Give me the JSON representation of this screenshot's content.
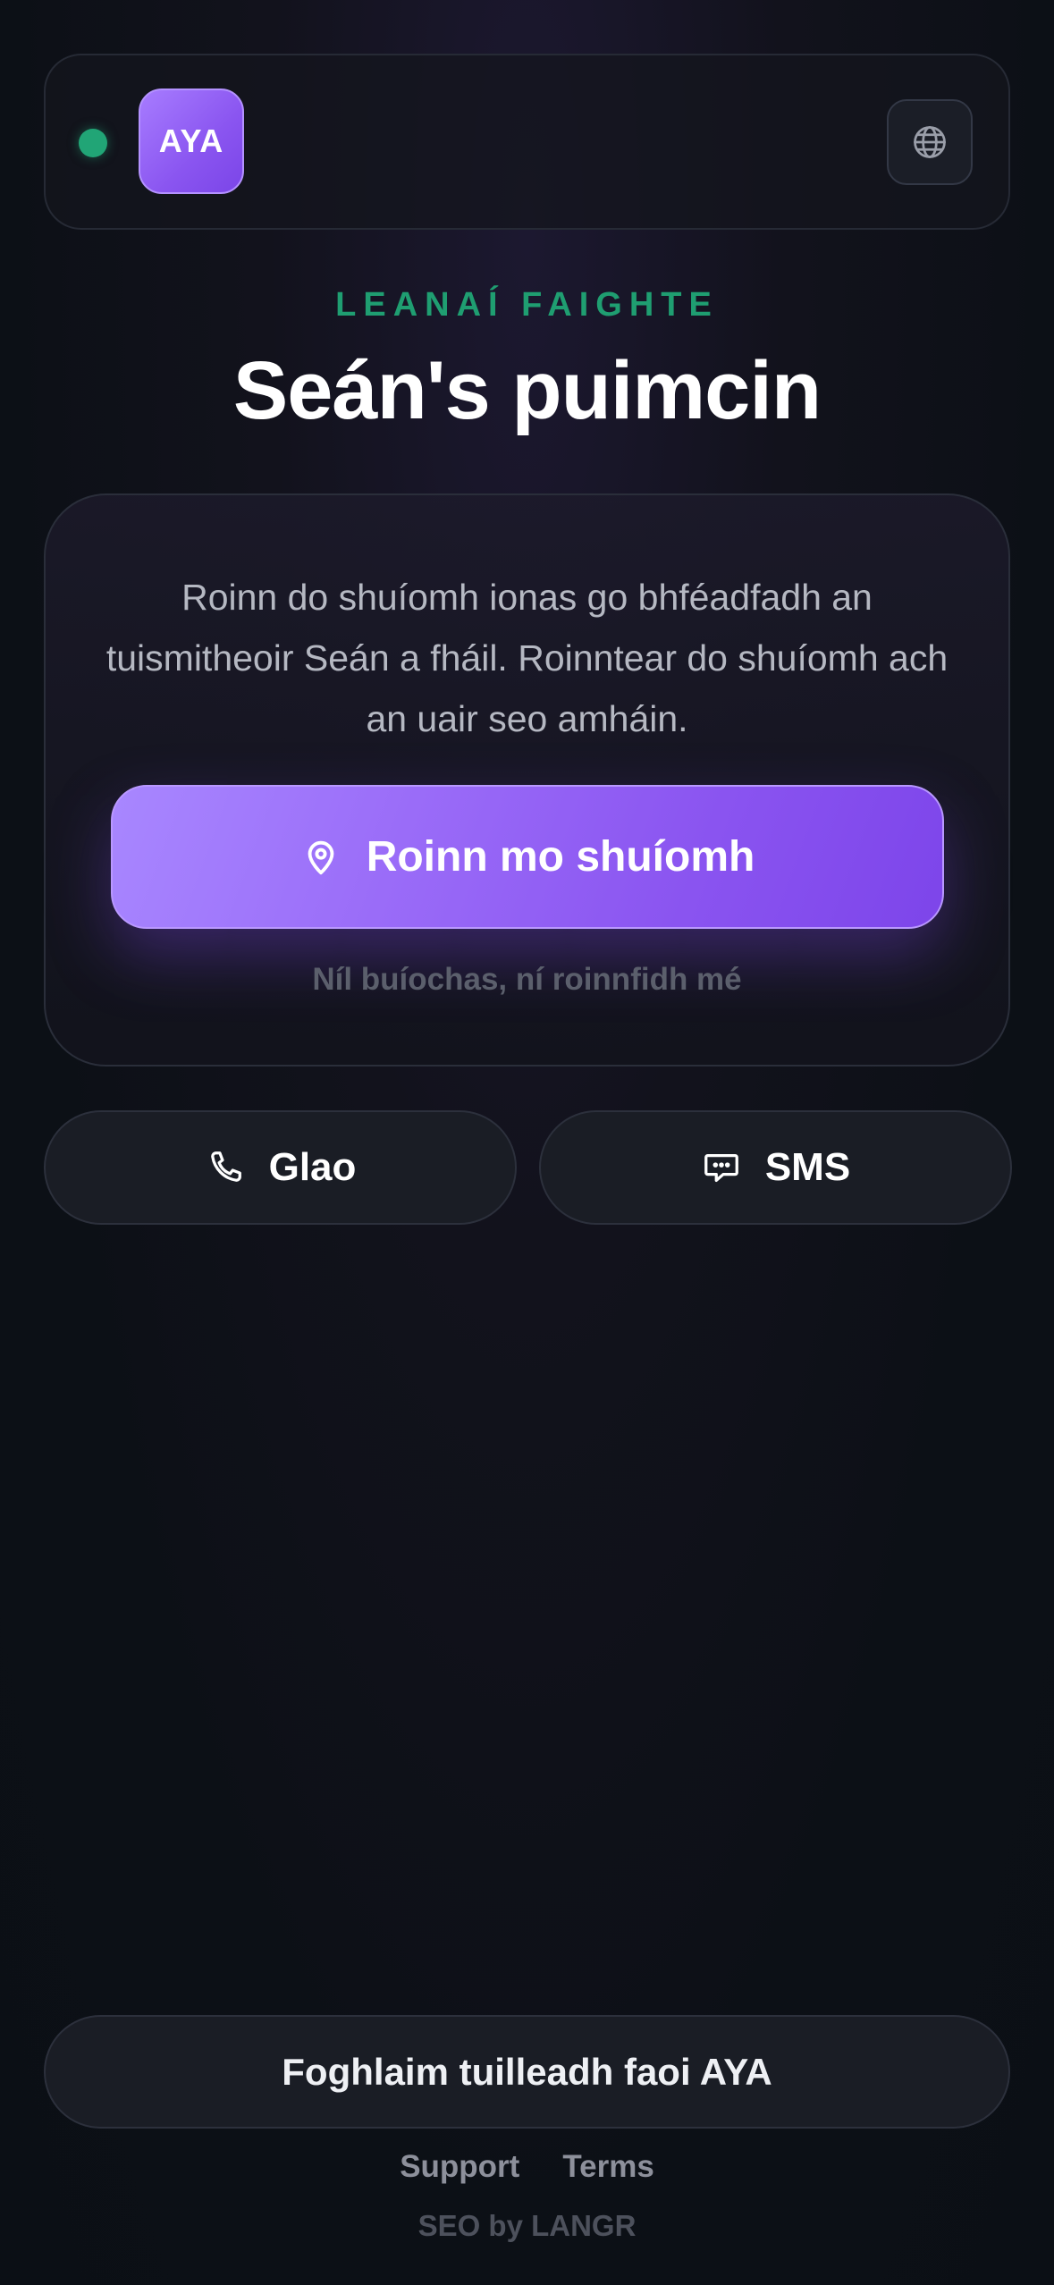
{
  "header": {
    "logo_text": "AYA",
    "status": "online",
    "status_color": "#21a576",
    "language_icon": "globe-icon"
  },
  "hero": {
    "eyebrow": "LEANAÍ FAIGHTE",
    "title": "Seán's puimcin"
  },
  "card": {
    "description": "Roinn do shuíomh ionas go bhféadfadh an tuismitheoir Seán a fháil. Roinntear do shuíomh ach an uair seo amháin.",
    "share_button_label": "Roinn mo shuíomh",
    "share_button_icon": "location-pin-icon",
    "decline_label": "Níl buíochas, ní roinnfidh mé"
  },
  "actions": {
    "call_label": "Glao",
    "call_icon": "phone-icon",
    "sms_label": "SMS",
    "sms_icon": "message-icon"
  },
  "footer": {
    "learn_more_label": "Foghlaim tuilleadh faoi AYA",
    "links": [
      "Support",
      "Terms"
    ],
    "credit": "SEO by LANGR"
  },
  "colors": {
    "accent": "#8a55f0",
    "eyebrow": "#1f9e71",
    "background": "#0c1016"
  }
}
